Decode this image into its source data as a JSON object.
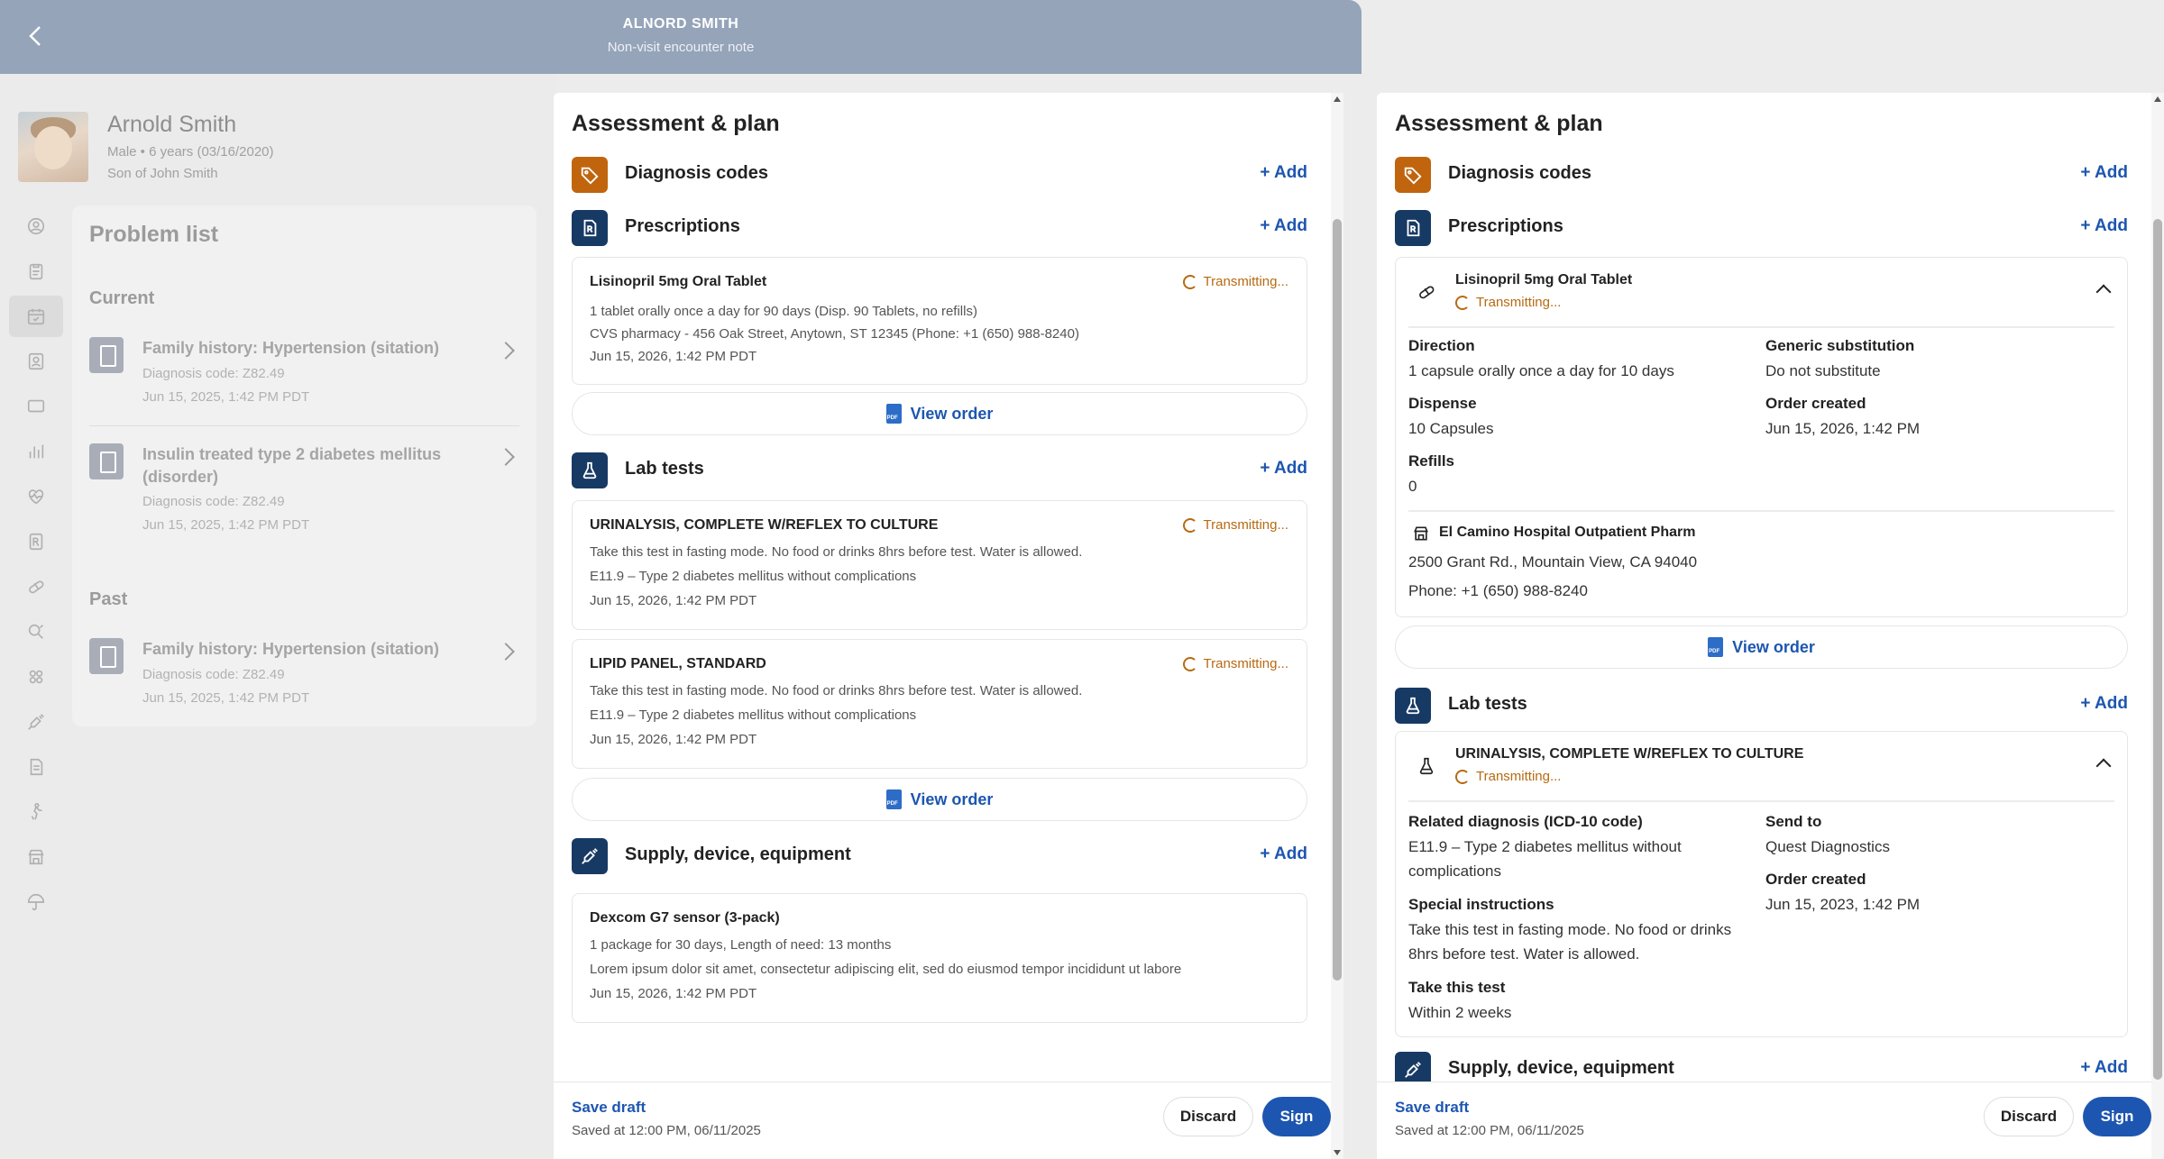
{
  "header": {
    "patient_name_caps": "ALNORD SMITH",
    "subtitle": "Non-visit encounter note"
  },
  "patient": {
    "name": "Arnold Smith",
    "meta": "Male • 6 years (03/16/2020)",
    "relation": "Son of John Smith"
  },
  "nav_icons": [
    "person-icon",
    "clipboard-icon",
    "calendar-check-icon",
    "contact-card-icon",
    "chat-icon",
    "bar-chart-icon",
    "heart-pulse-icon",
    "prescription-icon",
    "pill-icon",
    "shield-search-icon",
    "grid-icon",
    "syringe-icon",
    "document-icon",
    "walking-person-icon",
    "store-icon",
    "umbrella-icon"
  ],
  "problem_list": {
    "title": "Problem list",
    "current_label": "Current",
    "past_label": "Past",
    "current": [
      {
        "name": "Family history: Hypertension (sitation)",
        "code": "Diagnosis code: Z82.49",
        "date": "Jun 15, 2025, 1:42 PM PDT"
      },
      {
        "name": "Insulin treated type 2 diabetes mellitus (disorder)",
        "code": "Diagnosis code: Z82.49",
        "date": "Jun 15, 2025, 1:42 PM PDT"
      }
    ],
    "past": [
      {
        "name": "Family history: Hypertension (sitation)",
        "code": "Diagnosis code: Z82.49",
        "date": "Jun 15, 2025, 1:42 PM PDT"
      }
    ]
  },
  "panel1": {
    "title": "Assessment & plan",
    "add_label": "+ Add",
    "diagnosis_label": "Diagnosis codes",
    "prescriptions_label": "Prescriptions",
    "lab_label": "Lab tests",
    "supply_label": "Supply, device, equipment",
    "view_order": "View order",
    "transmitting": "Transmitting...",
    "rx": {
      "name": "Lisinopril 5mg Oral Tablet",
      "line1": "1 tablet orally once a day for 90 days (Disp. 90 Tablets, no refills)",
      "line2": "CVS pharmacy - 456 Oak Street, Anytown, ST 12345 (Phone: +1 (650) 988-8240)",
      "date": "Jun 15, 2026, 1:42 PM PDT"
    },
    "labs": [
      {
        "name": "URINALYSIS, COMPLETE W/REFLEX TO CULTURE",
        "line1": "Take this test in fasting mode. No food or drinks 8hrs before test. Water is allowed.",
        "line2": "E11.9 – Type 2 diabetes mellitus without complications",
        "date": "Jun 15, 2026, 1:42 PM PDT"
      },
      {
        "name": "LIPID PANEL, STANDARD",
        "line1": "Take this test in fasting mode. No food or drinks 8hrs before test. Water is allowed.",
        "line2": "E11.9 – Type 2 diabetes mellitus without complications",
        "date": "Jun 15, 2026, 1:42 PM PDT"
      }
    ],
    "supply": {
      "name": "Dexcom G7 sensor (3-pack)",
      "line1": "1 package for 30 days, Length of need: 13 months",
      "line2": "Lorem ipsum dolor sit amet, consectetur adipiscing elit, sed do eiusmod tempor incididunt ut labore",
      "date": "Jun 15, 2026, 1:42 PM PDT"
    },
    "footer": {
      "save_draft": "Save draft",
      "saved_at": "Saved at 12:00 PM, 06/11/2025",
      "discard": "Discard",
      "sign": "Sign"
    }
  },
  "panel2": {
    "title": "Assessment & plan",
    "add_label": "+ Add",
    "diagnosis_label": "Diagnosis codes",
    "prescriptions_label": "Prescriptions",
    "lab_label": "Lab tests",
    "supply_label": "Supply, device, equipment",
    "view_order": "View order",
    "transmitting": "Transmitting...",
    "rx": {
      "name": "Lisinopril 5mg Oral Tablet",
      "direction_label": "Direction",
      "direction": "1 capsule orally once a day for 10 days",
      "generic_label": "Generic substitution",
      "generic": "Do not substitute",
      "dispense_label": "Dispense",
      "dispense": "10 Capsules",
      "created_label": "Order created",
      "created": "Jun 15, 2026, 1:42 PM",
      "refills_label": "Refills",
      "refills": "0",
      "pharmacy_name": "El Camino Hospital Outpatient Pharm",
      "pharmacy_address": "2500 Grant Rd., Mountain View, CA 94040",
      "pharmacy_phone": "Phone: +1 (650) 988-8240"
    },
    "lab": {
      "name": "URINALYSIS, COMPLETE W/REFLEX TO CULTURE",
      "diag_label": "Related diagnosis (ICD-10 code)",
      "diag": "E11.9 – Type 2 diabetes mellitus without complications",
      "sendto_label": "Send to",
      "sendto": "Quest Diagnostics",
      "special_label": "Special instructions",
      "special": "Take this test in fasting mode. No food or drinks 8hrs before test. Water is allowed.",
      "created_label": "Order created",
      "created": "Jun 15, 2023, 1:42 PM",
      "take_label": "Take this test",
      "take": "Within 2 weeks"
    },
    "footer": {
      "save_draft": "Save draft",
      "saved_at": "Saved at 12:00 PM, 06/11/2025",
      "discard": "Discard",
      "sign": "Sign"
    }
  },
  "colors": {
    "accent": "#1d56b0",
    "header": "#95a4b9",
    "diagnosis_icon": "#c0650e",
    "section_icon": "#173a64",
    "transmitting": "#b66a12"
  }
}
